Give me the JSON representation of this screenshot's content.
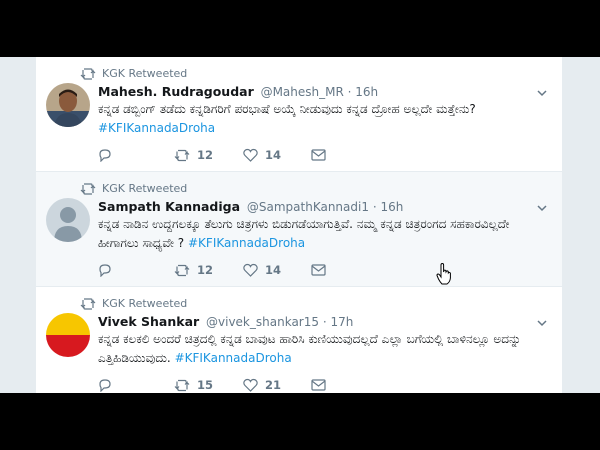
{
  "timeline": {
    "tweets": [
      {
        "retweeted_by": "KGK Retweeted",
        "name": "Mahesh. Rudragoudar",
        "handle": "@Mahesh_MR",
        "time": "· 16h",
        "text": "ಕನ್ನಡ ಡಬ್ಬಿಂಗ್ ತಡೆದು ಕನ್ನಡಿಗರಿಗೆ ಪರಭಾಷೆ ಅಯ್ಕೆ ನೀಡುವುದು ಕನ್ನಡ ದ್ರೋಹ ಅಲ್ಲದೇ ಮತ್ತೇನು?",
        "hashtag": "#KFIKannadaDroha",
        "reply_count": "",
        "retweet_count": "12",
        "like_count": "14"
      },
      {
        "retweeted_by": "KGK Retweeted",
        "name": "Sampath Kannadiga",
        "handle": "@SampathKannadi1",
        "time": "· 16h",
        "text": "ಕನ್ನಡ ನಾಡಿನ ಉದ್ದಗಲಕ್ಕೂ ತೆಲುಗು ಚಿತ್ರಗಳು ಬಿಡುಗಡೆಯಾಗುತ್ತಿವೆ. ನಮ್ಮ ಕನ್ನಡ ಚಿತ್ರರಂಗದ ಸಹಕಾರವಿಲ್ಲದೇ ಹೀಗಾಗಲು ಸಾಧ್ಯವೇ ?",
        "hashtag": "#KFIKannadaDroha",
        "reply_count": "",
        "retweet_count": "12",
        "like_count": "14"
      },
      {
        "retweeted_by": "KGK Retweeted",
        "name": "Vivek Shankar",
        "handle": "@vivek_shankar15",
        "time": "· 17h",
        "text": "ಕನ್ನಡ ಕಲಕಲಿ ಅಂದರೆ ಚಿತ್ರದಲ್ಲಿ ಕನ್ನಡ ಬಾವುಟ ಹಾರಿಸಿ ಕುಣಿಯುವುದಲ್ಲದೆ ಎಲ್ಲಾ ಬಗೆಯಲ್ಲಿ ಬಾಳಿನಲ್ಲೂ ಅದನ್ನು ಎತ್ತಿಹಿಡಿಯುವುದು.",
        "hashtag": "#KFIKannadaDroha",
        "reply_count": "",
        "retweet_count": "15",
        "like_count": "21"
      }
    ]
  },
  "colors": {
    "link": "#1b95e0",
    "muted": "#657786",
    "text": "#14171a",
    "hover_bg": "#f5f8fa",
    "avatar_flag_top": "#f7c600",
    "avatar_flag_bottom": "#d7191f"
  },
  "icons": [
    "retweet-icon",
    "reply-icon",
    "like-icon",
    "message-icon",
    "chevron-down-icon",
    "hand-cursor-icon"
  ]
}
